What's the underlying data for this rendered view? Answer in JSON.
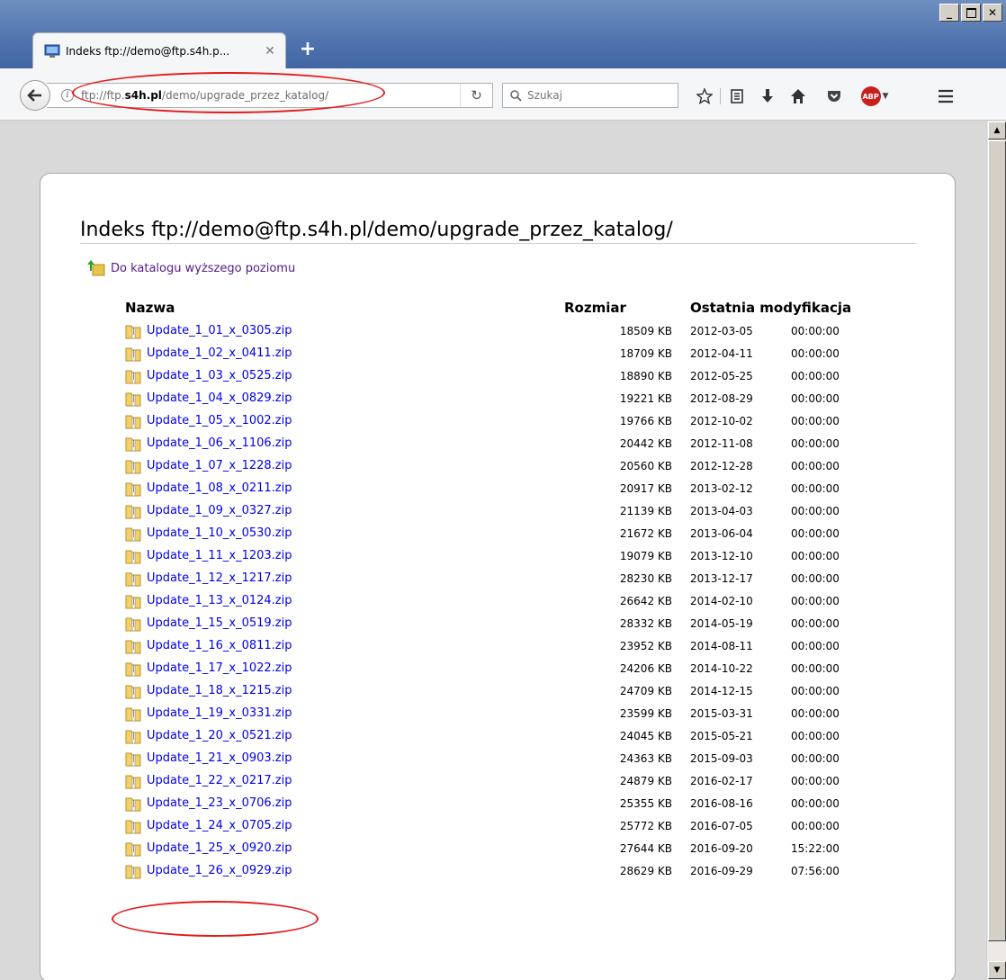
{
  "tab": {
    "title": "Indeks ftp://demo@ftp.s4h.p..."
  },
  "urlbar": {
    "url_pre": "ftp://ftp.",
    "url_host": "s4h.pl",
    "url_post": "/demo/upgrade_przez_katalog/"
  },
  "search": {
    "placeholder": "Szukaj"
  },
  "page": {
    "heading": "Indeks ftp://demo@ftp.s4h.pl/demo/upgrade_przez_katalog/",
    "up_link": "Do katalogu wyższego poziomu",
    "columns": {
      "name": "Nazwa",
      "size": "Rozmiar",
      "modified": "Ostatnia modyfikacja"
    },
    "files": [
      {
        "name": "Update_1_01_x_0305.zip",
        "size": "18509 KB",
        "date": "2012-03-05",
        "time": "00:00:00"
      },
      {
        "name": "Update_1_02_x_0411.zip",
        "size": "18709 KB",
        "date": "2012-04-11",
        "time": "00:00:00"
      },
      {
        "name": "Update_1_03_x_0525.zip",
        "size": "18890 KB",
        "date": "2012-05-25",
        "time": "00:00:00"
      },
      {
        "name": "Update_1_04_x_0829.zip",
        "size": "19221 KB",
        "date": "2012-08-29",
        "time": "00:00:00"
      },
      {
        "name": "Update_1_05_x_1002.zip",
        "size": "19766 KB",
        "date": "2012-10-02",
        "time": "00:00:00"
      },
      {
        "name": "Update_1_06_x_1106.zip",
        "size": "20442 KB",
        "date": "2012-11-08",
        "time": "00:00:00"
      },
      {
        "name": "Update_1_07_x_1228.zip",
        "size": "20560 KB",
        "date": "2012-12-28",
        "time": "00:00:00"
      },
      {
        "name": "Update_1_08_x_0211.zip",
        "size": "20917 KB",
        "date": "2013-02-12",
        "time": "00:00:00"
      },
      {
        "name": "Update_1_09_x_0327.zip",
        "size": "21139 KB",
        "date": "2013-04-03",
        "time": "00:00:00"
      },
      {
        "name": "Update_1_10_x_0530.zip",
        "size": "21672 KB",
        "date": "2013-06-04",
        "time": "00:00:00"
      },
      {
        "name": "Update_1_11_x_1203.zip",
        "size": "19079 KB",
        "date": "2013-12-10",
        "time": "00:00:00"
      },
      {
        "name": "Update_1_12_x_1217.zip",
        "size": "28230 KB",
        "date": "2013-12-17",
        "time": "00:00:00"
      },
      {
        "name": "Update_1_13_x_0124.zip",
        "size": "26642 KB",
        "date": "2014-02-10",
        "time": "00:00:00"
      },
      {
        "name": "Update_1_15_x_0519.zip",
        "size": "28332 KB",
        "date": "2014-05-19",
        "time": "00:00:00"
      },
      {
        "name": "Update_1_16_x_0811.zip",
        "size": "23952 KB",
        "date": "2014-08-11",
        "time": "00:00:00"
      },
      {
        "name": "Update_1_17_x_1022.zip",
        "size": "24206 KB",
        "date": "2014-10-22",
        "time": "00:00:00"
      },
      {
        "name": "Update_1_18_x_1215.zip",
        "size": "24709 KB",
        "date": "2014-12-15",
        "time": "00:00:00"
      },
      {
        "name": "Update_1_19_x_0331.zip",
        "size": "23599 KB",
        "date": "2015-03-31",
        "time": "00:00:00"
      },
      {
        "name": "Update_1_20_x_0521.zip",
        "size": "24045 KB",
        "date": "2015-05-21",
        "time": "00:00:00"
      },
      {
        "name": "Update_1_21_x_0903.zip",
        "size": "24363 KB",
        "date": "2015-09-03",
        "time": "00:00:00"
      },
      {
        "name": "Update_1_22_x_0217.zip",
        "size": "24879 KB",
        "date": "2016-02-17",
        "time": "00:00:00"
      },
      {
        "name": "Update_1_23_x_0706.zip",
        "size": "25355 KB",
        "date": "2016-08-16",
        "time": "00:00:00"
      },
      {
        "name": "Update_1_24_x_0705.zip",
        "size": "25772 KB",
        "date": "2016-07-05",
        "time": "00:00:00"
      },
      {
        "name": "Update_1_25_x_0920.zip",
        "size": "27644 KB",
        "date": "2016-09-20",
        "time": "15:22:00"
      },
      {
        "name": "Update_1_26_x_0929.zip",
        "size": "28629 KB",
        "date": "2016-09-29",
        "time": "07:56:00"
      }
    ]
  },
  "colors": {
    "link": "#0000ee",
    "visited": "#551a8b",
    "highlight": "#e21a1a"
  },
  "icons": [
    "monitor-icon",
    "close-icon",
    "plus-icon",
    "back-arrow-icon",
    "info-icon",
    "reload-icon",
    "search-icon",
    "star-icon",
    "reading-list-icon",
    "download-icon",
    "home-icon",
    "pocket-icon",
    "abp-icon",
    "hamburger-menu-icon",
    "folder-up-icon",
    "zip-file-icon"
  ]
}
